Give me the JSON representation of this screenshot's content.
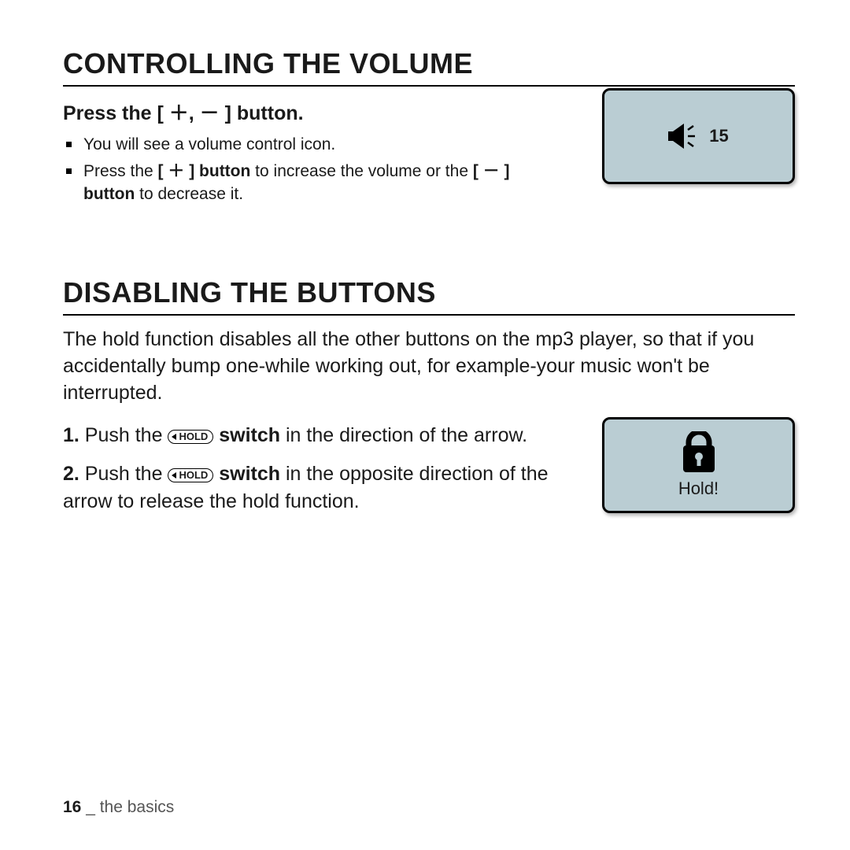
{
  "section1": {
    "title": "CONTROLLING THE VOLUME",
    "subhead_pre": "Press the ",
    "subhead_buttons": "[ ＋, － ] button",
    "subhead_post": ".",
    "bullet1": "You will see a volume control icon.",
    "bullet2_a": "Press the ",
    "bullet2_b": "[ ＋ ] button",
    "bullet2_c": " to increase the volume or the ",
    "bullet2_d": "[ － ] button",
    "bullet2_e": " to decrease it.",
    "volume_value": "15"
  },
  "section2": {
    "title": "DISABLING THE BUTTONS",
    "intro": "The hold function disables all the other buttons on the mp3 player, so that if you accidentally bump one-while working out, for example-your music won't be interrupted.",
    "step1_num": "1.",
    "step1_a": " Push the ",
    "step1_switch": "HOLD",
    "step1_b": "switch",
    "step1_c": " in the direction of the arrow.",
    "step2_num": "2.",
    "step2_a": " Push the ",
    "step2_switch": "HOLD",
    "step2_b": "switch",
    "step2_c": " in the opposite direction of the arrow to release the hold function.",
    "hold_label": "Hold!"
  },
  "footer": {
    "page": "16",
    "sep": " _ ",
    "chapter": "the basics"
  }
}
